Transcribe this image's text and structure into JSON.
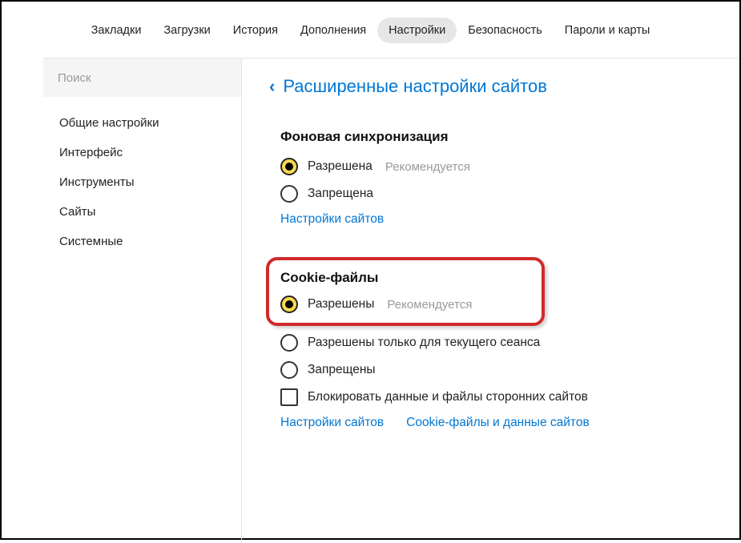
{
  "nav": {
    "items": [
      "Закладки",
      "Загрузки",
      "История",
      "Дополнения",
      "Настройки",
      "Безопасность",
      "Пароли и карты"
    ],
    "activeIndex": 4
  },
  "sidebar": {
    "searchPlaceholder": "Поиск",
    "items": [
      "Общие настройки",
      "Интерфейс",
      "Инструменты",
      "Сайты",
      "Системные"
    ]
  },
  "breadcrumb": {
    "chevron": "‹",
    "title": "Расширенные настройки сайтов"
  },
  "sections": {
    "bgSync": {
      "title": "Фоновая синхронизация",
      "options": [
        {
          "label": "Разрешена",
          "reco": "Рекомендуется",
          "selected": true
        },
        {
          "label": "Запрещена",
          "selected": false
        }
      ],
      "links": [
        "Настройки сайтов"
      ]
    },
    "cookies": {
      "title": "Cookie-файлы",
      "options": [
        {
          "label": "Разрешены",
          "reco": "Рекомендуется",
          "selected": true
        },
        {
          "label": "Разрешены только для текущего сеанса",
          "selected": false
        },
        {
          "label": "Запрещены",
          "selected": false
        }
      ],
      "checkbox": {
        "label": "Блокировать данные и файлы сторонних сайтов",
        "checked": false
      },
      "links": [
        "Настройки сайтов",
        "Cookie-файлы и данные сайтов"
      ]
    }
  }
}
